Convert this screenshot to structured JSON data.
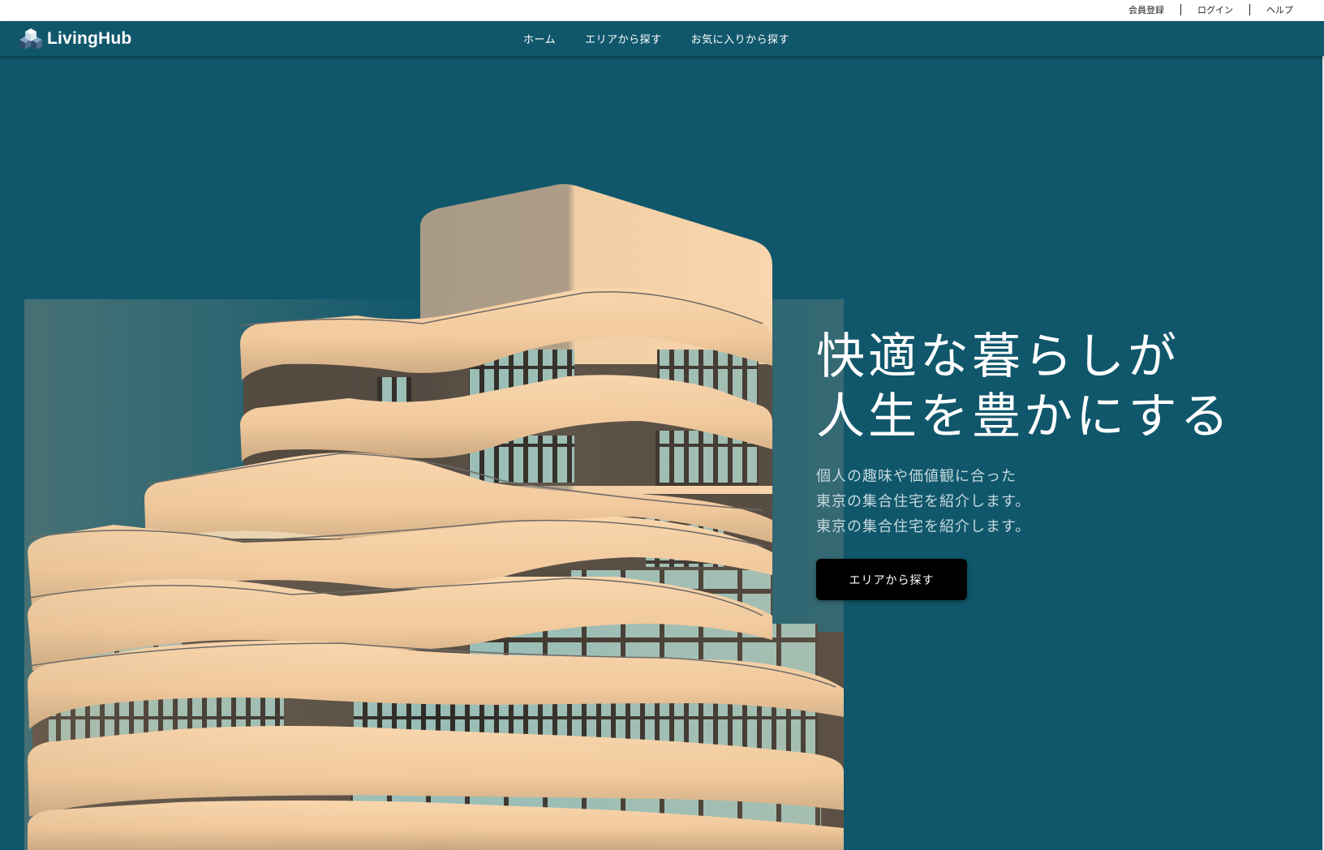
{
  "utility_nav": {
    "register": "会員登録",
    "login": "ログイン",
    "help": "ヘルプ"
  },
  "brand": {
    "name": "LivingHub",
    "logo_icon": "cubes-logo-icon"
  },
  "main_nav": {
    "items": [
      {
        "label": "ホーム"
      },
      {
        "label": "エリアから探す"
      },
      {
        "label": "お気に入りから探す"
      }
    ]
  },
  "hero": {
    "headline": [
      "快適な暮らしが",
      "人生を豊かにする"
    ],
    "subtext": [
      "個人の趣味や価値観に合った",
      "東京の集合住宅を紹介します。",
      "東京の集合住宅を紹介します。"
    ],
    "cta_label": "エリアから探す",
    "illustration_icon": "apartment-building-illustration"
  },
  "colors": {
    "nav_background": "#10576b",
    "hero_background": "#10576b",
    "building_facade": "#f9d6ad",
    "window_glass": "#98bdb6",
    "cta_background": "#000000"
  }
}
